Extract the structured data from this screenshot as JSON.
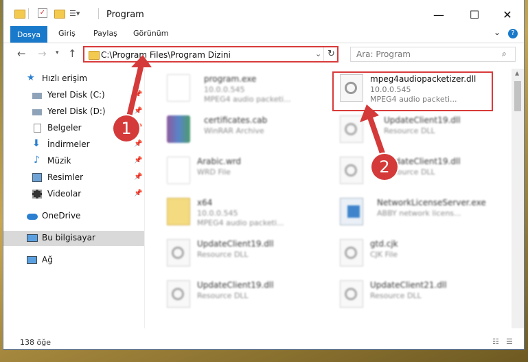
{
  "window": {
    "title": "Program",
    "controls": {
      "minimize": "—",
      "maximize": "☐",
      "close": "✕"
    }
  },
  "ribbon": {
    "tabs": [
      "Dosya",
      "Giriş",
      "Paylaş",
      "Görünüm"
    ],
    "expand": "⌄",
    "help": "?"
  },
  "address": {
    "path": "C:\\Program Files\\Program Dizini",
    "search_placeholder": "Ara: Program"
  },
  "sidebar": {
    "items": [
      {
        "label": "Hızlı erişim",
        "icon": "star-icon",
        "pinned": false
      },
      {
        "label": "Yerel Disk (C:)",
        "icon": "drive-icon",
        "pinned": true
      },
      {
        "label": "Yerel Disk (D:)",
        "icon": "drive-icon",
        "pinned": true
      },
      {
        "label": "Belgeler",
        "icon": "documents-icon",
        "pinned": true
      },
      {
        "label": "İndirmeler",
        "icon": "download-icon",
        "pinned": true
      },
      {
        "label": "Müzik",
        "icon": "music-icon",
        "pinned": true
      },
      {
        "label": "Resimler",
        "icon": "pictures-icon",
        "pinned": true
      },
      {
        "label": "Videolar",
        "icon": "video-icon",
        "pinned": true
      },
      {
        "label": "OneDrive",
        "icon": "cloud-icon",
        "pinned": false
      },
      {
        "label": "Bu bilgisayar",
        "icon": "computer-icon",
        "pinned": false
      },
      {
        "label": "Ağ",
        "icon": "network-icon",
        "pinned": false
      }
    ]
  },
  "files": [
    {
      "name": "program.exe",
      "sub1": "10.0.0.545",
      "sub2": "MPEG4 audio packeti...",
      "icon": "exe-icon"
    },
    {
      "name": "mpeg4audiopacketizer.dll",
      "sub1": "10.0.0.545",
      "sub2": "MPEG4 audio packeti...",
      "icon": "dll-icon"
    },
    {
      "name": "certificates.cab",
      "sub1": "WinRAR Archive",
      "sub2": "",
      "icon": "archive-icon"
    },
    {
      "name": "UpdateClient19.dll",
      "sub1": "Resource DLL",
      "sub2": "",
      "icon": "dll-icon"
    },
    {
      "name": "Arabic.wrd",
      "sub1": "WRD File",
      "sub2": "",
      "icon": "file-icon"
    },
    {
      "name": "UpdateClient19.dll",
      "sub1": "Resource DLL",
      "sub2": "",
      "icon": "dll-icon"
    },
    {
      "name": "x64",
      "sub1": "10.0.0.545",
      "sub2": "MPEG4 audio packeti...",
      "icon": "folder-icon"
    },
    {
      "name": "NetworkLicenseServer.exe",
      "sub1": "ABBY network licens...",
      "sub2": "",
      "icon": "app-icon"
    },
    {
      "name": "UpdateClient19.dll",
      "sub1": "Resource DLL",
      "sub2": "",
      "icon": "dll-icon"
    },
    {
      "name": "gtd.cjk",
      "sub1": "CJK File",
      "sub2": "",
      "icon": "dll-icon"
    },
    {
      "name": "UpdateClient19.dll",
      "sub1": "Resource DLL",
      "sub2": "",
      "icon": "dll-icon"
    },
    {
      "name": "UpdateClient21.dll",
      "sub1": "Resource DLL",
      "sub2": "",
      "icon": "dll-icon"
    }
  ],
  "status": {
    "count": "138 öğe"
  },
  "annotations": {
    "step1": "1",
    "step2": "2"
  },
  "colors": {
    "accent": "#1979ca",
    "highlight_red": "#d93a3a"
  }
}
